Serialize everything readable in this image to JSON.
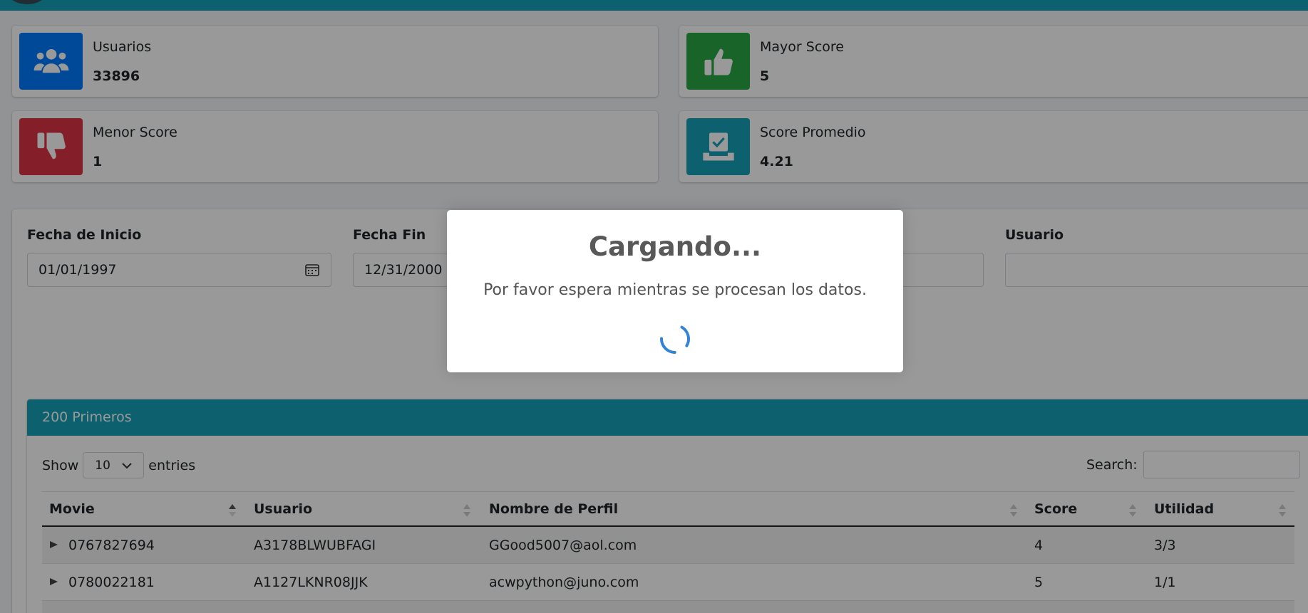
{
  "stats": {
    "usuarios": {
      "label": "Usuarios",
      "value": "33896",
      "icon": "users-icon",
      "color": "#007bff"
    },
    "mayor": {
      "label": "Mayor Score",
      "value": "5",
      "icon": "thumbs-up-icon",
      "color": "#28a745"
    },
    "menor": {
      "label": "Menor Score",
      "value": "1",
      "icon": "thumbs-down-icon",
      "color": "#dc3545"
    },
    "promedio": {
      "label": "Score Promedio",
      "value": "4.21",
      "icon": "vote-box-icon",
      "color": "#17a2b8"
    }
  },
  "filters": {
    "fecha_inicio": {
      "label": "Fecha de Inicio",
      "value": "01/01/1997"
    },
    "fecha_fin": {
      "label": "Fecha Fin",
      "value": "12/31/2000"
    },
    "usuario": {
      "label": "Usuario",
      "value": ""
    }
  },
  "table": {
    "title": "200 Primeros",
    "show_label": "Show",
    "entries_value": "10",
    "entries_label": "entries",
    "search_label": "Search:",
    "columns": [
      "Movie",
      "Usuario",
      "Nombre de Perfil",
      "Score",
      "Utilidad"
    ],
    "rows": [
      {
        "movie": "0767827694",
        "usuario": "A3178BLWUBFAGI",
        "perfil": "GGood5007@aol.com",
        "score": "4",
        "utilidad": "3/3"
      },
      {
        "movie": "0780022181",
        "usuario": "A1127LKNR08JJK",
        "perfil": "acwpython@juno.com",
        "score": "5",
        "utilidad": "1/1"
      }
    ]
  },
  "modal": {
    "title": "Cargando...",
    "text": "Por favor espera mientras se procesan los datos."
  }
}
